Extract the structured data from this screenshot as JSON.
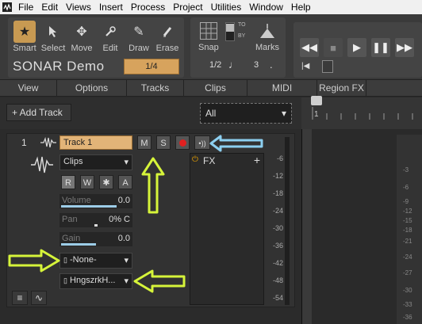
{
  "menubar": {
    "items": [
      "File",
      "Edit",
      "Views",
      "Insert",
      "Process",
      "Project",
      "Utilities",
      "Window",
      "Help"
    ]
  },
  "tools": {
    "smart": "Smart",
    "select": "Select",
    "move": "Move",
    "edit": "Edit",
    "draw": "Draw",
    "erase": "Erase",
    "app_title": "SONAR Demo",
    "snap_resolution": "1/4"
  },
  "snap_panel": {
    "snap_label": "Snap",
    "marks_label": "Marks",
    "to_label": "TO",
    "by_label": "BY",
    "note_value": "1/2",
    "triplet": "3",
    "dot": "."
  },
  "view_menus": [
    "View",
    "Options",
    "Tracks",
    "Clips",
    "MIDI",
    "Region FX"
  ],
  "track_header": {
    "add_track": "+ Add Track",
    "filter": "All"
  },
  "ruler": {
    "bar_label": "1"
  },
  "track": {
    "number": "1",
    "name": "Track 1",
    "mute": "M",
    "solo": "S",
    "view_mode": "Clips",
    "r": "R",
    "w": "W",
    "a": "A",
    "volume_label": "Volume",
    "volume_value": "0.0",
    "pan_label": "Pan",
    "pan_value": "0% C",
    "gain_label": "Gain",
    "gain_value": "0.0",
    "input": "-None-",
    "output": "HngszrkH...",
    "fx_label": "FX",
    "fx_add": "+"
  },
  "meter_scale": [
    "-6",
    "-12",
    "-18",
    "-24",
    "-30",
    "-36",
    "-42",
    "-48",
    "-54"
  ],
  "right_scale": [
    "-3",
    "-6",
    "-9",
    "-12",
    "-15",
    "-18",
    "-21",
    "-24",
    "-27",
    "-30",
    "-33",
    "-36"
  ],
  "colors": {
    "accent": "#d7a35d",
    "record": "#e02020",
    "arrow_green": "#d6f43a",
    "arrow_blue": "#8ccff0"
  }
}
